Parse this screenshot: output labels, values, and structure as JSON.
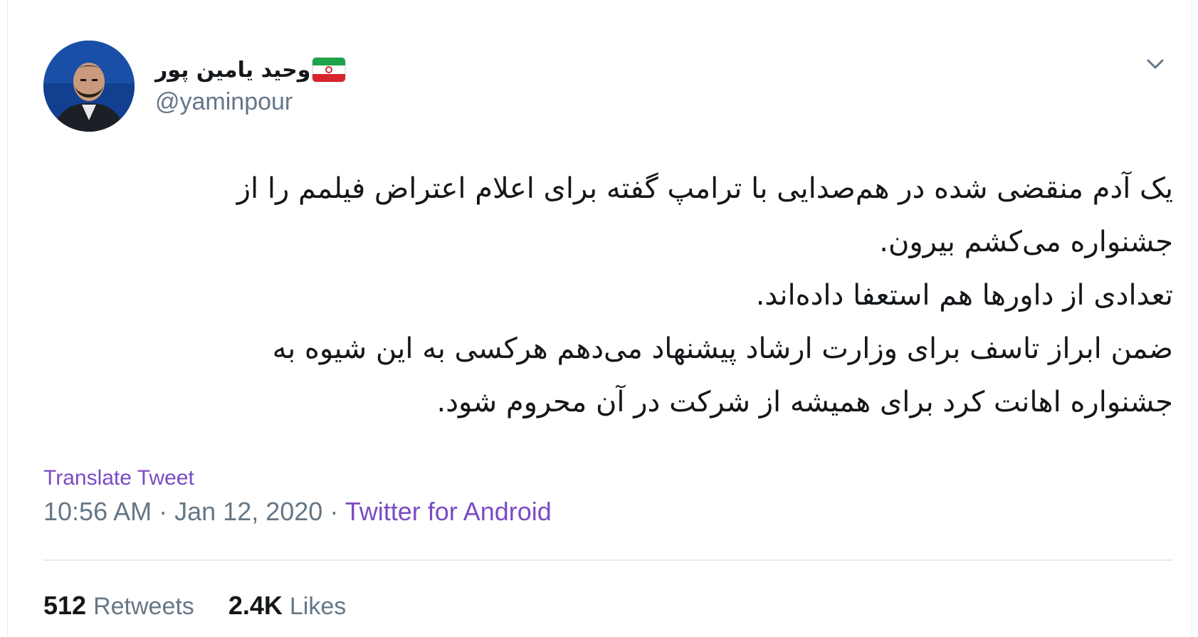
{
  "author": {
    "display_name": "وحید یامین پور",
    "handle": "@yaminpour",
    "avatar_icon": "profile-photo",
    "flag_icon": "iran-flag-emoji"
  },
  "tweet": {
    "lines": [
      "یک آدم منقضی شده در هم‌صدایی با ترامپ گفته برای اعلام اعتراض فیلمم را از",
      "جشنواره می‌کشم بیرون.",
      "تعدادی از داورها هم استعفا داده‌اند.",
      "ضمن ابراز تاسف برای وزارت ارشاد پیشنهاد می‌دهم هرکسی به این شیوه به",
      "جشنواره اهانت کرد برای همیشه از شرکت در آن محروم شود."
    ],
    "translate_label": "Translate Tweet"
  },
  "meta": {
    "time": "10:56 AM",
    "separator": "·",
    "date": "Jan 12, 2020",
    "source": "Twitter for Android"
  },
  "stats": {
    "retweets_count": "512",
    "retweets_label": "Retweets",
    "likes_count": "2.4K",
    "likes_label": "Likes"
  },
  "colors": {
    "link": "#794bc4",
    "secondary": "#657786",
    "text": "#14171a"
  }
}
